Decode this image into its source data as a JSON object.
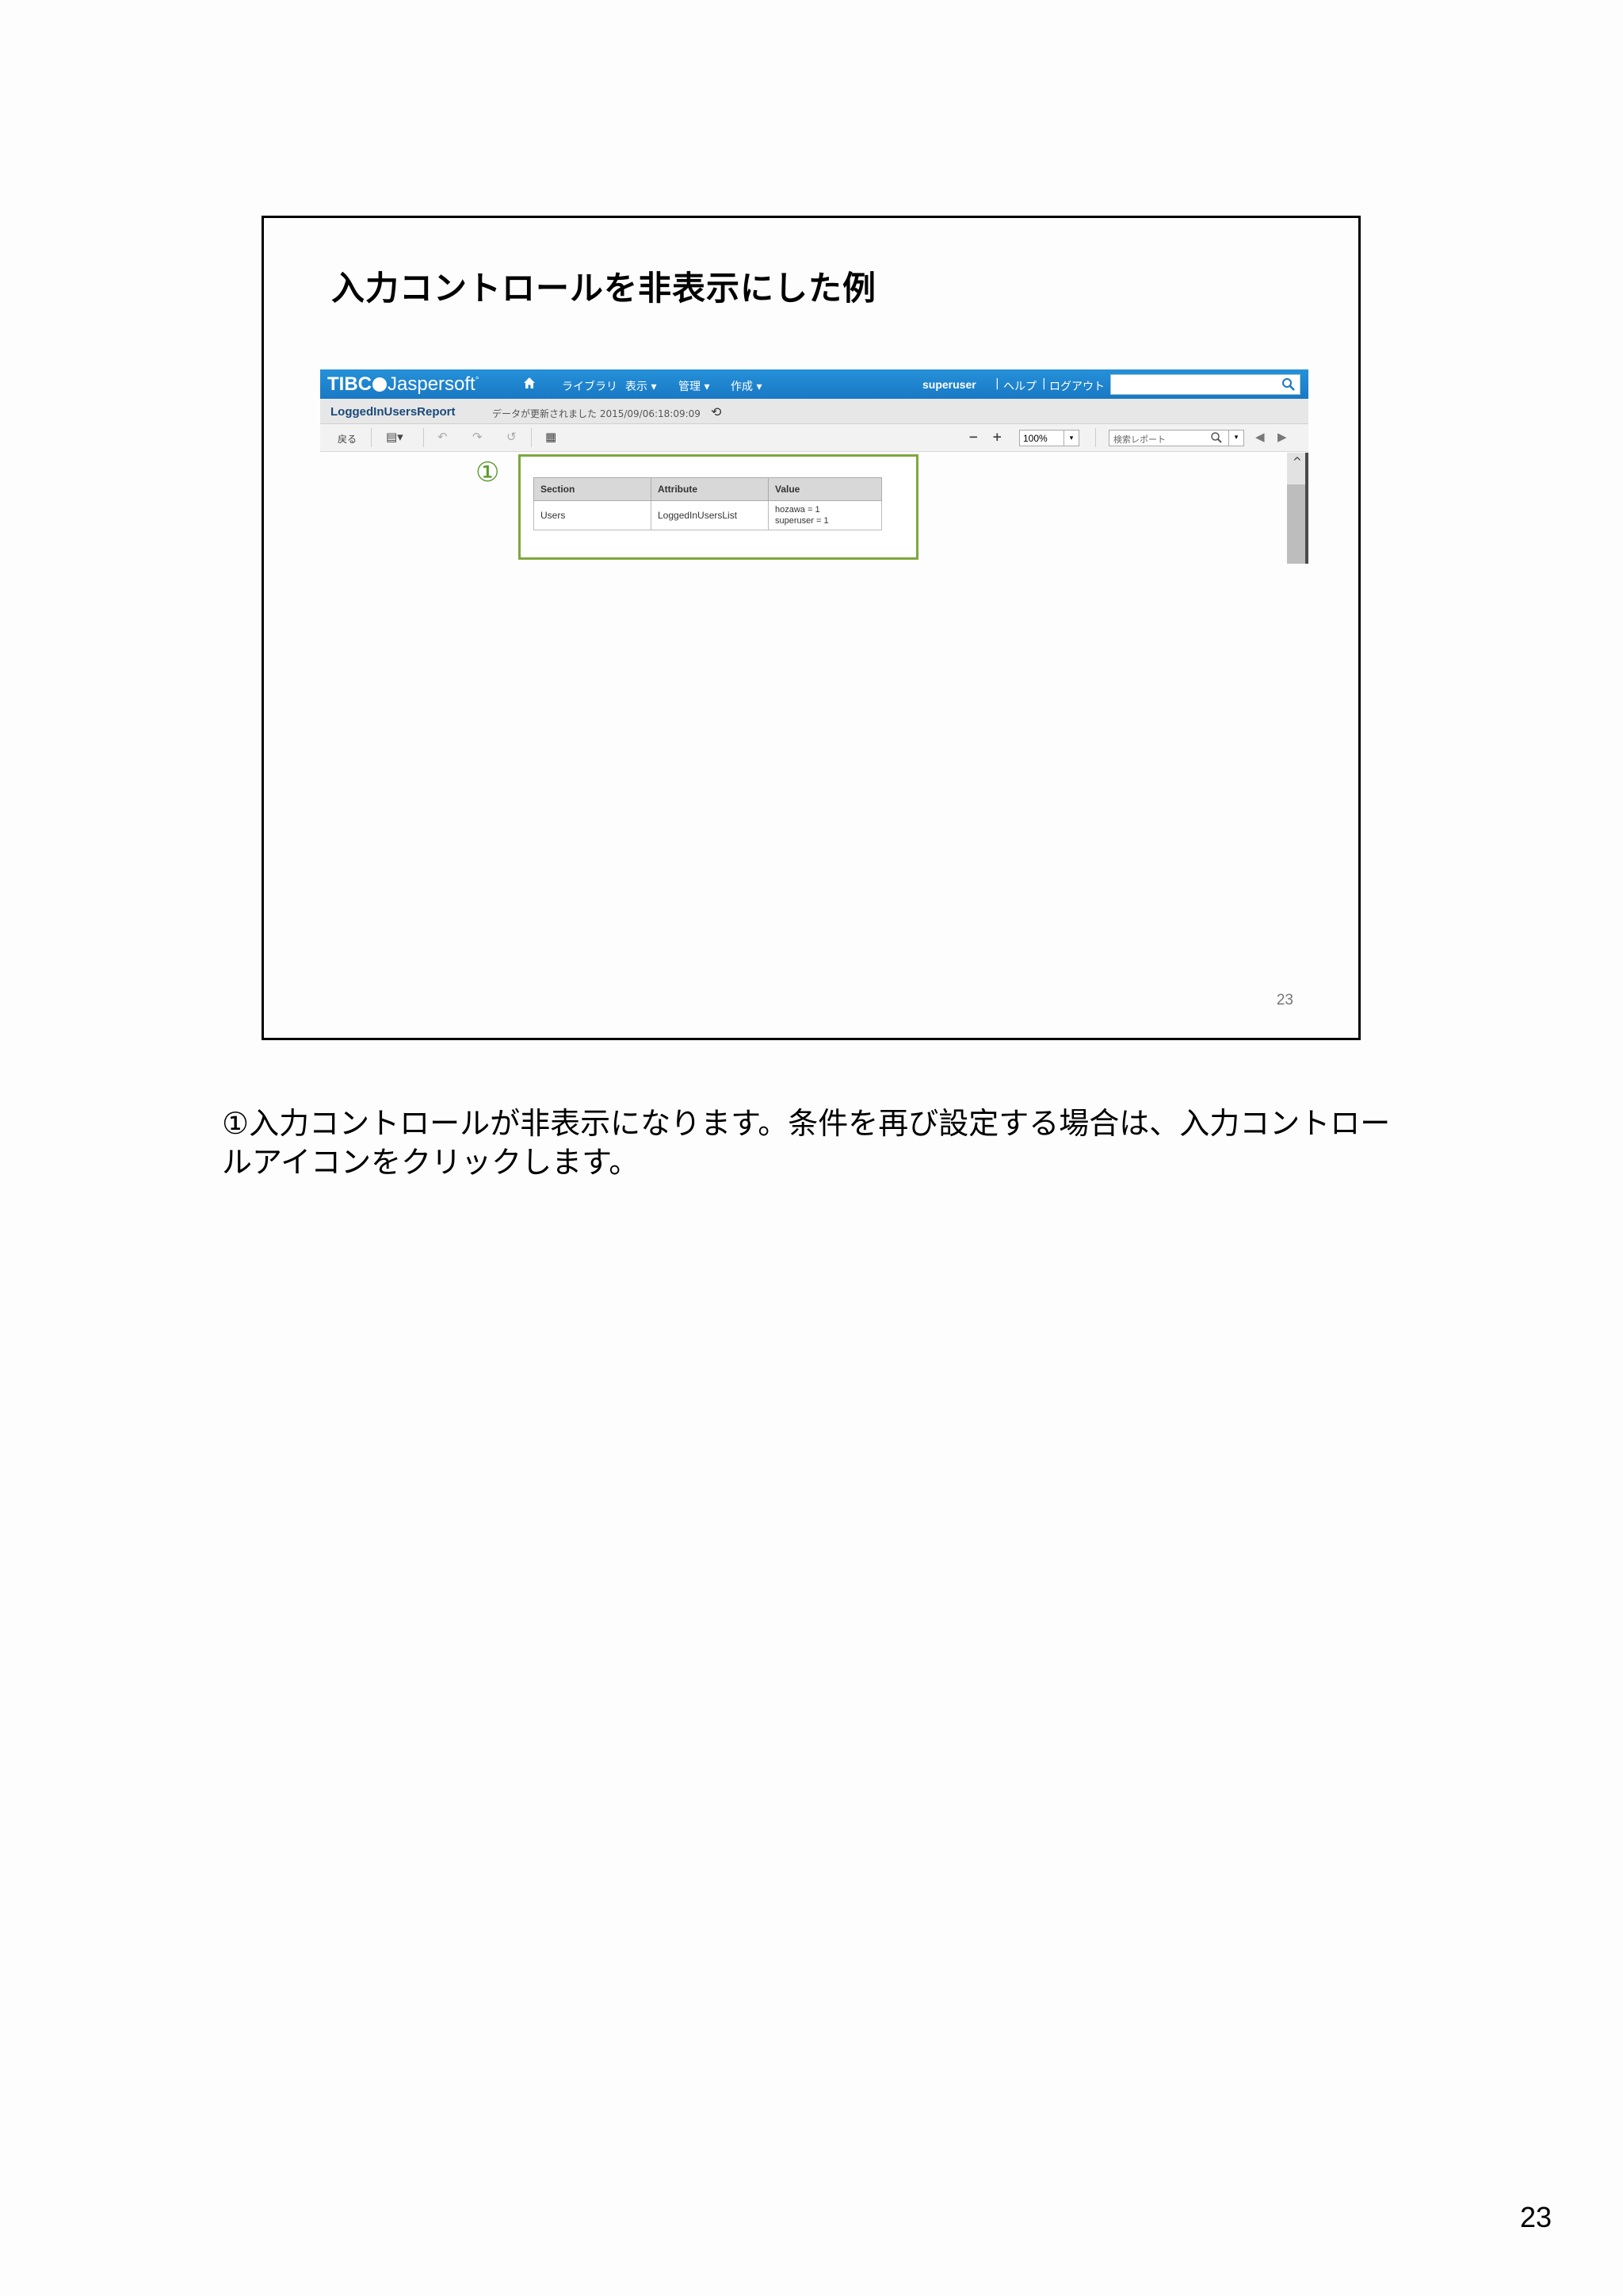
{
  "slide": {
    "title": "入力コントロールを非表示にした例",
    "number": "23"
  },
  "app": {
    "logo_prefix": "TIBC",
    "logo_suffix": "Jaspersoft",
    "logo_reg": "°",
    "nav": [
      "ライブラリ",
      "表示 ▾",
      "管理 ▾",
      "作成 ▾"
    ],
    "user": "superuser",
    "help": "ヘルプ",
    "logout": "ログアウト",
    "report_name": "LoggedInUsersReport",
    "updated_text": "データが更新されました 2015/09/06:18:09:09",
    "back_label": "戻る",
    "zoom": "100%",
    "find_placeholder": "検索レポート",
    "marker": "①",
    "table": {
      "headers": [
        "Section",
        "Attribute",
        "Value"
      ],
      "rows": [
        {
          "section": "Users",
          "attribute": "LoggedInUsersList",
          "value_lines": [
            "hozawa = 1",
            "superuser = 1"
          ]
        }
      ]
    },
    "colors": {
      "topbar": "#1978c4",
      "highlight": "#7fa73f"
    }
  },
  "caption": "①入力コントロールが非表示になります。条件を再び設定する場合は、入力コントロールアイコンをクリックします。",
  "page_number": "23"
}
